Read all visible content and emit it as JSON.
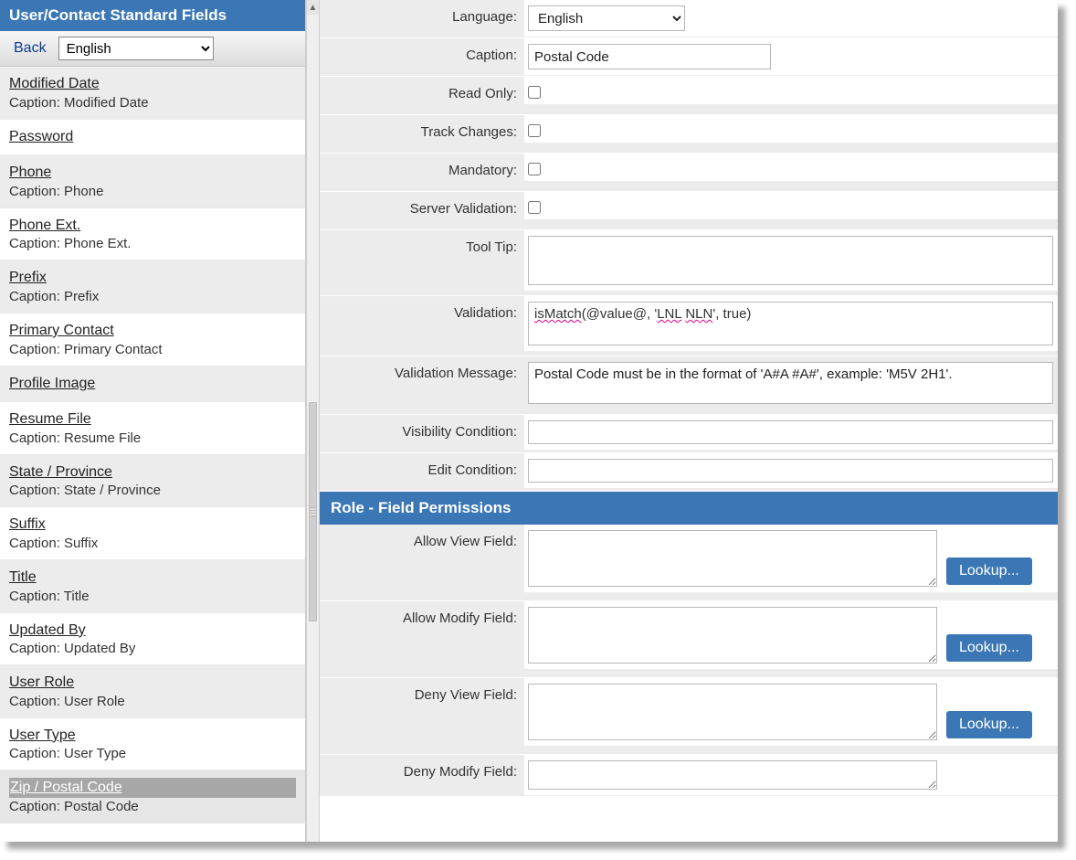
{
  "sidebar": {
    "title": "User/Contact Standard Fields",
    "back_label": "Back",
    "language_value": "English",
    "items": [
      {
        "name": "Modified Date",
        "caption": "Caption: Modified Date",
        "alt": true
      },
      {
        "name": "Password",
        "caption": "",
        "alt": false
      },
      {
        "name": "Phone",
        "caption": "Caption: Phone",
        "alt": true
      },
      {
        "name": "Phone Ext.",
        "caption": "Caption: Phone Ext.",
        "alt": false
      },
      {
        "name": "Prefix",
        "caption": "Caption: Prefix",
        "alt": true
      },
      {
        "name": "Primary Contact",
        "caption": "Caption: Primary Contact",
        "alt": false
      },
      {
        "name": "Profile Image",
        "caption": "",
        "alt": true
      },
      {
        "name": "Resume File",
        "caption": "Caption: Resume File",
        "alt": false
      },
      {
        "name": "State / Province",
        "caption": "Caption: State / Province",
        "alt": true
      },
      {
        "name": "Suffix",
        "caption": "Caption: Suffix",
        "alt": false
      },
      {
        "name": "Title",
        "caption": "Caption: Title",
        "alt": true
      },
      {
        "name": "Updated By",
        "caption": "Caption: Updated By",
        "alt": false
      },
      {
        "name": "User Role",
        "caption": "Caption: User Role",
        "alt": true
      },
      {
        "name": "User Type",
        "caption": "Caption: User Type",
        "alt": false
      },
      {
        "name": "Zip / Postal Code",
        "caption": "Caption: Postal Code",
        "alt": true,
        "selected": true
      }
    ]
  },
  "form": {
    "labels": {
      "language": "Language:",
      "caption": "Caption:",
      "read_only": "Read Only:",
      "track_changes": "Track Changes:",
      "mandatory": "Mandatory:",
      "server_validation": "Server Validation:",
      "tool_tip": "Tool Tip:",
      "validation": "Validation:",
      "validation_message": "Validation Message:",
      "visibility_condition": "Visibility Condition:",
      "edit_condition": "Edit Condition:"
    },
    "values": {
      "language": "English",
      "caption": "Postal Code",
      "read_only": false,
      "track_changes": false,
      "mandatory": false,
      "server_validation": false,
      "tool_tip": "",
      "validation_prefix": "isMatch",
      "validation_arg1": "(@value@, '",
      "validation_spell1": "LNL",
      "validation_mid": " ",
      "validation_spell2": "NLN",
      "validation_suffix": "', true)",
      "validation_message": "Postal Code must be in the format of 'A#A #A#', example: 'M5V 2H1'.",
      "visibility_condition": "",
      "edit_condition": ""
    }
  },
  "permissions": {
    "header": "Role - Field Permissions",
    "lookup_label": "Lookup...",
    "rows": [
      {
        "label": "Allow View Field:",
        "value": ""
      },
      {
        "label": "Allow Modify Field:",
        "value": ""
      },
      {
        "label": "Deny View Field:",
        "value": ""
      },
      {
        "label": "Deny Modify Field:",
        "value": ""
      }
    ]
  }
}
